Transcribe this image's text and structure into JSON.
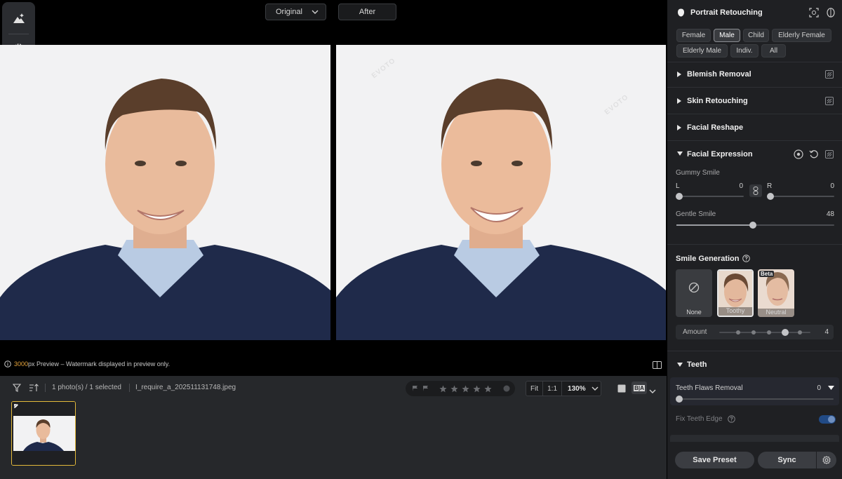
{
  "compare": {
    "original_label": "Original",
    "after_label": "After"
  },
  "watermark": "EVOTO",
  "preview": {
    "px": "3000",
    "text": "px Preview – Watermark displayed in preview only."
  },
  "film_toolbar": {
    "selection": "1 photo(s) / 1 selected",
    "filename": "I_require_a_202511131748.jpeg",
    "zoom_fit": "Fit",
    "zoom_1to1": "1:1",
    "zoom_value": "130%",
    "ba_label": "B|A"
  },
  "panel": {
    "title": "Portrait Retouching",
    "chips": [
      "Female",
      "Male",
      "Child",
      "Elderly Female",
      "Elderly Male",
      "Indiv.",
      "All"
    ],
    "active_chip": "Male",
    "sections": {
      "blemish": "Blemish Removal",
      "skin": "Skin Retouching",
      "reshape": "Facial Reshape",
      "expression": "Facial Expression",
      "teeth": "Teeth"
    },
    "gummy": {
      "label": "Gummy Smile",
      "l_label": "L",
      "l_value": "0",
      "r_label": "R",
      "r_value": "0"
    },
    "gentle": {
      "label": "Gentle Smile",
      "value": "48"
    },
    "smile_gen": {
      "label": "Smile Generation",
      "options": [
        "None",
        "Toothy",
        "Neutral"
      ],
      "selected": "Toothy",
      "beta_badge": "Beta",
      "amount_label": "Amount",
      "amount_value": "4"
    },
    "teeth_flaws": {
      "label": "Teeth Flaws Removal",
      "value": "0"
    },
    "fix_edge": {
      "label": "Fix Teeth Edge",
      "enabled": true
    },
    "footer": {
      "save_preset": "Save Preset",
      "sync": "Sync"
    }
  },
  "colors": {
    "accent_gold": "#e6a43b",
    "toggle_blue": "#214a85",
    "suit_navy": "#1f2a4a"
  }
}
